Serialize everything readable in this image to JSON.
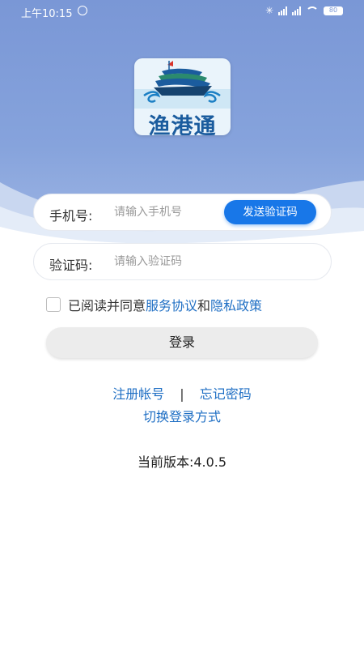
{
  "status_bar": {
    "time": "上午10:15",
    "battery": "80"
  },
  "app": {
    "logo_text": "渔港通"
  },
  "form": {
    "phone_label": "手机号:",
    "phone_placeholder": "请输入手机号",
    "send_code_label": "发送验证码",
    "code_label": "验证码:",
    "code_placeholder": "请输入验证码"
  },
  "agreement": {
    "prefix": "已阅读并同意",
    "service_link": "服务协议",
    "and": "和",
    "privacy_link": "隐私政策",
    "checked": false
  },
  "actions": {
    "login_label": "登录",
    "register_label": "注册帐号",
    "separator": "|",
    "forgot_label": "忘记密码",
    "switch_login_label": "切换登录方式"
  },
  "footer": {
    "version_text": "当前版本:4.0.5"
  },
  "colors": {
    "header_blue": "#7a97d6",
    "primary_button": "#1877e8",
    "link_blue": "#1f6fc4"
  }
}
